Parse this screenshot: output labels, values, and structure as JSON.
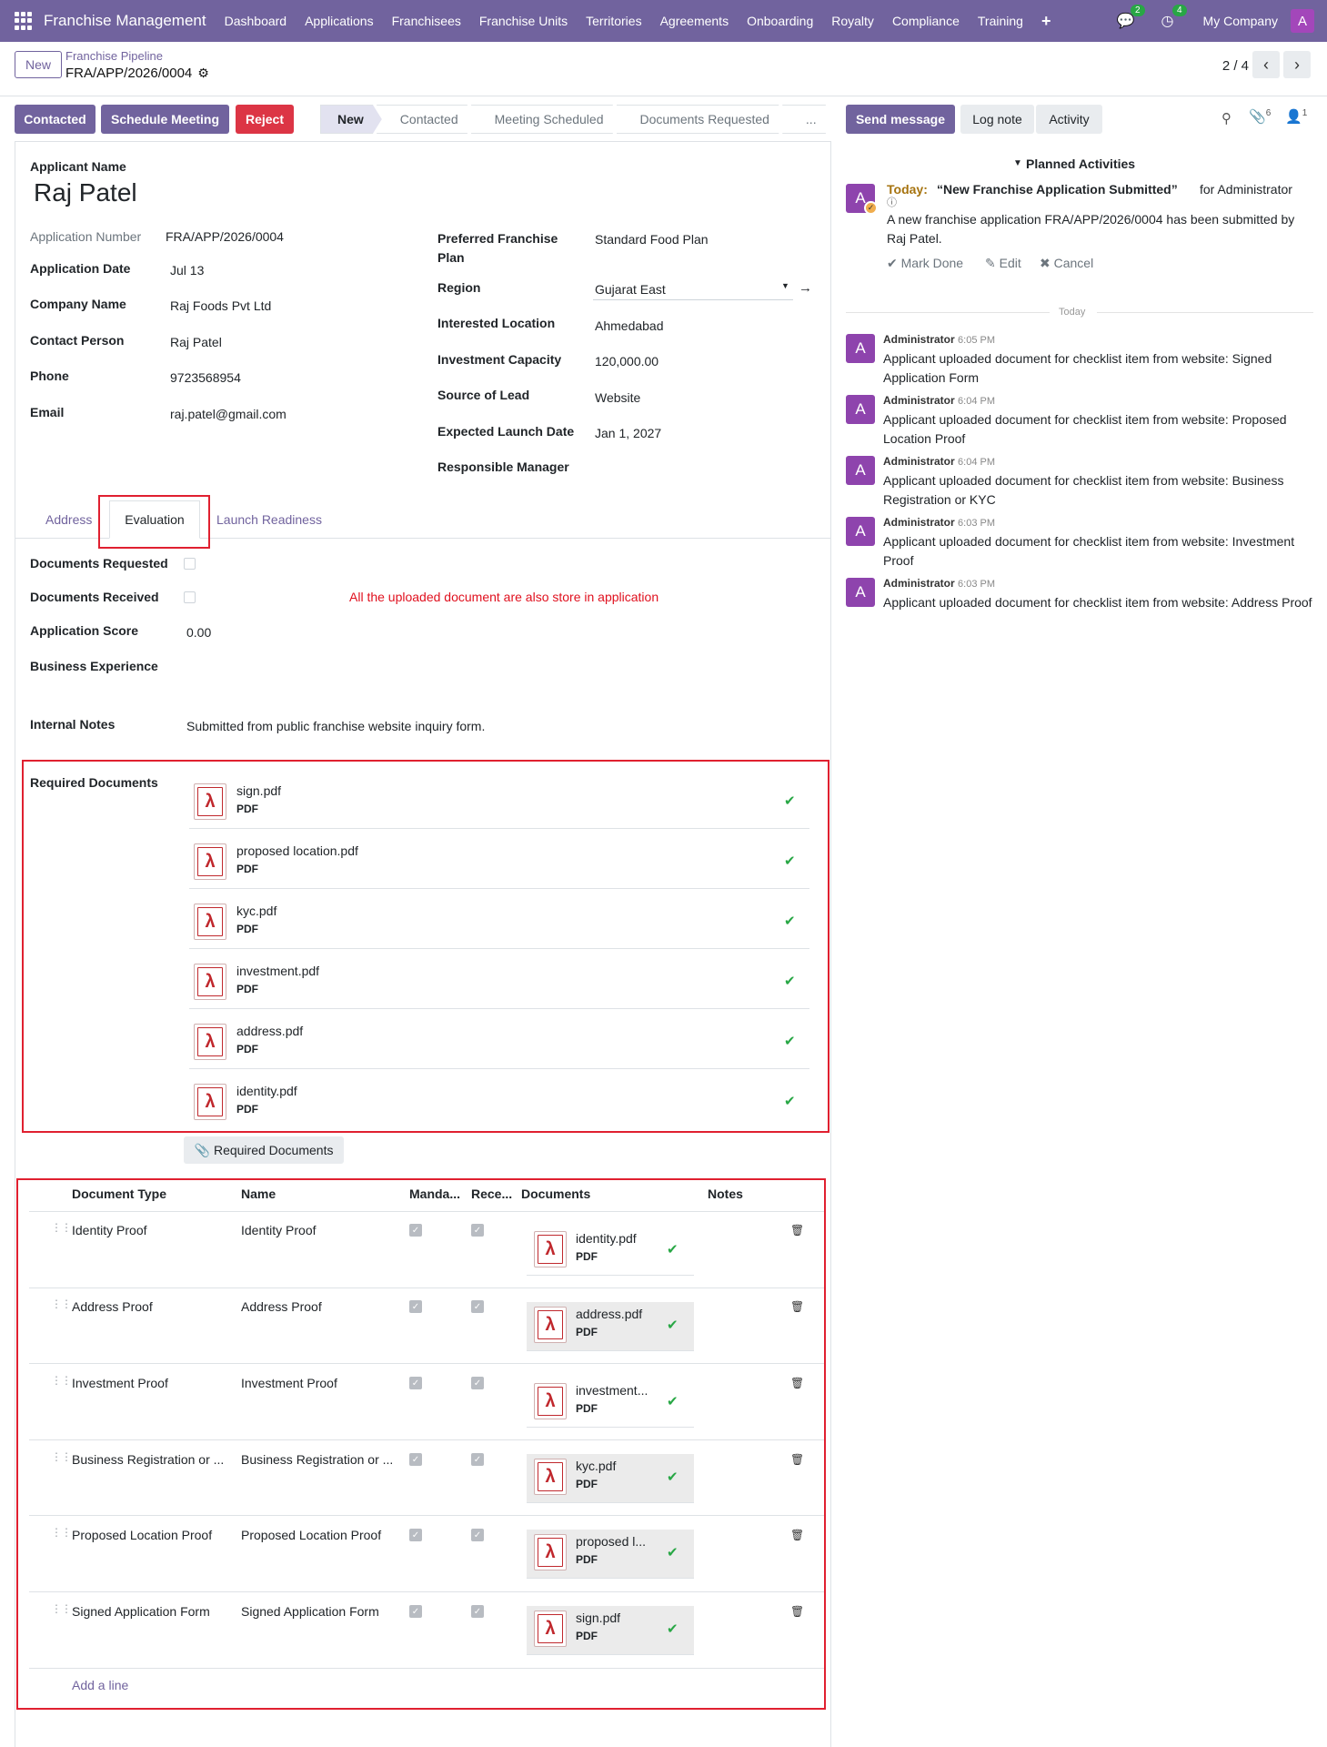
{
  "nav": {
    "brand": "Franchise Management",
    "items": [
      "Dashboard",
      "Applications",
      "Franchisees",
      "Franchise Units",
      "Territories",
      "Agreements",
      "Onboarding",
      "Royalty",
      "Compliance",
      "Training"
    ],
    "messages_badge": "2",
    "activities_badge": "4",
    "company": "My Company",
    "avatar": "A"
  },
  "control": {
    "new_button": "New",
    "breadcrumb_parent": "Franchise Pipeline",
    "breadcrumb_current": "FRA/APP/2026/0004",
    "pager": "2 / 4"
  },
  "actions": {
    "contacted": "Contacted",
    "schedule_meeting": "Schedule Meeting",
    "reject": "Reject"
  },
  "stages": [
    "New",
    "Contacted",
    "Meeting Scheduled",
    "Documents Requested",
    "..."
  ],
  "form": {
    "applicant_name_label": "Applicant Name",
    "applicant_name": "Raj Patel",
    "left": [
      {
        "label": "Application Number",
        "value": "FRA/APP/2026/0004"
      },
      {
        "label": "Application Date",
        "value": "Jul 13"
      },
      {
        "label": "Company Name",
        "value": "Raj Foods Pvt Ltd"
      },
      {
        "label": "Contact Person",
        "value": "Raj Patel"
      },
      {
        "label": "Phone",
        "value": "9723568954"
      },
      {
        "label": "Email",
        "value": "raj.patel@gmail.com"
      }
    ],
    "right": [
      {
        "label": "Preferred Franchise Plan",
        "value": "Standard Food Plan"
      },
      {
        "label": "Region",
        "value": "Gujarat East"
      },
      {
        "label": "Interested Location",
        "value": "Ahmedabad"
      },
      {
        "label": "Investment Capacity",
        "value": "120,000.00"
      },
      {
        "label": "Source of Lead",
        "value": "Website"
      },
      {
        "label": "Expected Launch Date",
        "value": "Jan 1, 2027"
      },
      {
        "label": "Responsible Manager",
        "value": ""
      }
    ]
  },
  "tabs": {
    "address": "Address",
    "evaluation": "Evaluation",
    "launch_readiness": "Launch Readiness"
  },
  "evaluation": {
    "documents_requested_label": "Documents Requested",
    "documents_received_label": "Documents Received",
    "application_score_label": "Application Score",
    "application_score": "0.00",
    "business_experience_label": "Business Experience",
    "internal_notes_label": "Internal Notes",
    "internal_notes": "Submitted from public franchise website inquiry form.",
    "annotation": "All the uploaded document are also store in application",
    "required_documents_label": "Required Documents",
    "attachments": [
      {
        "name": "sign.pdf",
        "type": "PDF"
      },
      {
        "name": "proposed location.pdf",
        "type": "PDF"
      },
      {
        "name": "kyc.pdf",
        "type": "PDF"
      },
      {
        "name": "investment.pdf",
        "type": "PDF"
      },
      {
        "name": "address.pdf",
        "type": "PDF"
      },
      {
        "name": "identity.pdf",
        "type": "PDF"
      }
    ],
    "required_documents_button": "Required Documents"
  },
  "doc_table": {
    "headers": [
      "Document Type",
      "Name",
      "Manda...",
      "Rece...",
      "Documents",
      "Notes"
    ],
    "rows": [
      {
        "doc_type": "Identity Proof",
        "name": "Identity Proof",
        "file": "identity.pdf",
        "file_type": "PDF"
      },
      {
        "doc_type": "Address Proof",
        "name": "Address Proof",
        "file": "address.pdf",
        "file_type": "PDF"
      },
      {
        "doc_type": "Investment Proof",
        "name": "Investment Proof",
        "file": "investment...",
        "file_type": "PDF"
      },
      {
        "doc_type": "Business Registration or ...",
        "name": "Business Registration or ...",
        "file": "kyc.pdf",
        "file_type": "PDF"
      },
      {
        "doc_type": "Proposed Location Proof",
        "name": "Proposed Location Proof",
        "file": "proposed l...",
        "file_type": "PDF"
      },
      {
        "doc_type": "Signed Application Form",
        "name": "Signed Application Form",
        "file": "sign.pdf",
        "file_type": "PDF"
      }
    ],
    "add_line": "Add a line"
  },
  "chatter": {
    "send_message": "Send message",
    "log_note": "Log note",
    "activity": "Activity",
    "attachments_count": "6",
    "followers_count": "1",
    "planned_activities": "Planned Activities",
    "activity_today": "Today:",
    "activity_title": "“New Franchise Application Submitted”",
    "activity_for": "for Administrator",
    "activity_body": "A new franchise application FRA/APP/2026/0004 has been submitted by Raj Patel.",
    "mark_done": "Mark Done",
    "edit": "Edit",
    "cancel": "Cancel",
    "today_divider": "Today",
    "messages": [
      {
        "author": "Administrator",
        "time": "6:05 PM",
        "body": "Applicant uploaded document for checklist item from website: Signed Application Form"
      },
      {
        "author": "Administrator",
        "time": "6:04 PM",
        "body": "Applicant uploaded document for checklist item from website: Proposed Location Proof"
      },
      {
        "author": "Administrator",
        "time": "6:04 PM",
        "body": "Applicant uploaded document for checklist item from website: Business Registration or KYC"
      },
      {
        "author": "Administrator",
        "time": "6:03 PM",
        "body": "Applicant uploaded document for checklist item from website: Investment Proof"
      },
      {
        "author": "Administrator",
        "time": "6:03 PM",
        "body": "Applicant uploaded document for checklist item from website: Address Proof"
      }
    ]
  },
  "colors": {
    "primary": "#71639e",
    "danger": "#dc3545",
    "success": "#28a745",
    "annotation_red": "#e02030"
  }
}
